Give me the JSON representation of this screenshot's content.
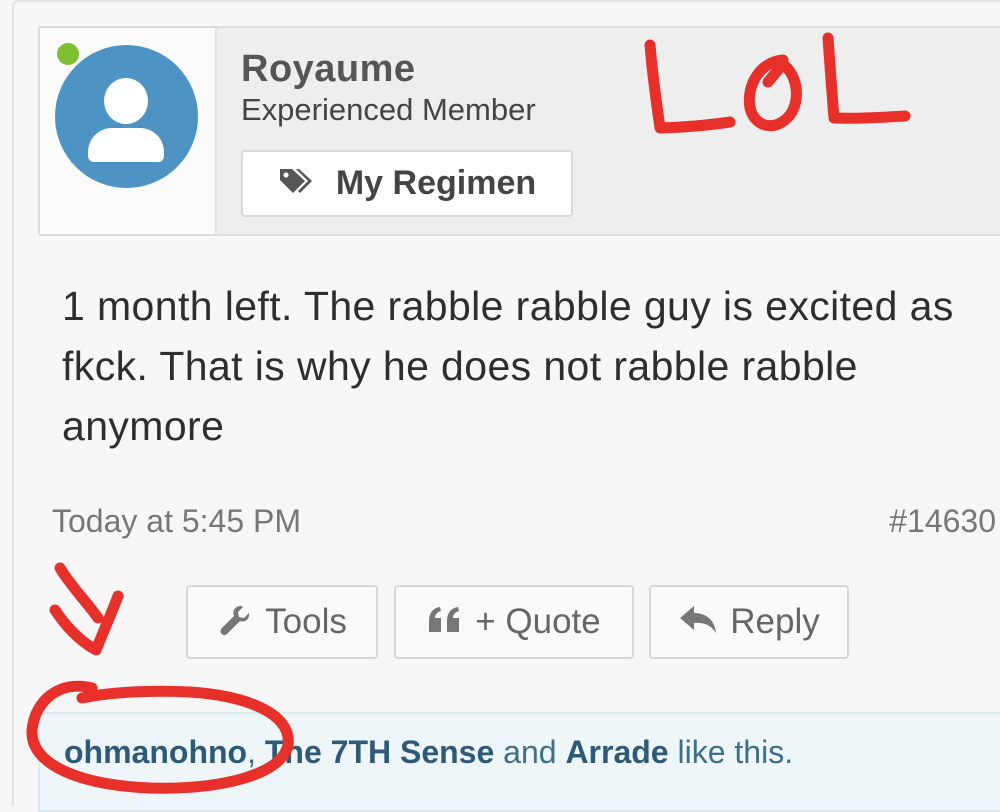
{
  "post": {
    "username": "Royaume",
    "user_title": "Experienced Member",
    "regimen_label": "My Regimen",
    "message": "1 month left. The rabble rabble guy is excited as fkck. That is why he does not rabble rabble anymore",
    "date": "Today at 5:45 PM",
    "post_number": "#14630",
    "actions": {
      "tools": "Tools",
      "quote": "+ Quote",
      "reply": "Reply"
    },
    "likes": {
      "user1": "ohmanohno",
      "separator1": ", ",
      "user2": "The 7TH Sense",
      "separator2": " and ",
      "user3": "Arrade",
      "suffix": " like this."
    }
  },
  "annotations": {
    "handwritten_text": "LOL",
    "ink_color": "#e8302a"
  },
  "colors": {
    "avatar_bg": "#4d94c4",
    "online_dot": "#7cbf2f",
    "likes_link": "#2e5a78"
  }
}
